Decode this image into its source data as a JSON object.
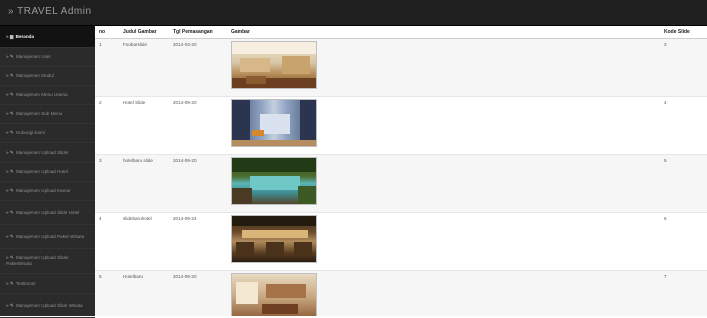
{
  "app": {
    "title": "TRAVEL Admin"
  },
  "sidebar": {
    "items": [
      {
        "icon": "home-icon",
        "label": "Beranda",
        "active": true
      },
      {
        "icon": "wrench-icon",
        "label": "Manajemen User"
      },
      {
        "icon": "wrench-icon",
        "label": "Manajemen Modul"
      },
      {
        "icon": "wrench-icon",
        "label": "Manajemen Menu Utama"
      },
      {
        "icon": "wrench-icon",
        "label": "Manajemen Sub Menu"
      },
      {
        "icon": "wrench-icon",
        "label": "Hubungi Kami"
      },
      {
        "icon": "wrench-icon",
        "label": "Manajemen Upload Slider"
      },
      {
        "icon": "wrench-icon",
        "label": "Manajemen Upload Hotel"
      },
      {
        "icon": "wrench-icon",
        "label": "Manajemen Upload Kamar"
      },
      {
        "icon": "wrench-icon",
        "label": "Manajemen Upload Slide Hotel"
      },
      {
        "icon": "wrench-icon",
        "label": "Manajemen Upload Paket Wisata"
      },
      {
        "icon": "wrench-icon",
        "label": "Manajemen Upload Slider PaketWisata"
      },
      {
        "icon": "wrench-icon",
        "label": "Testimoni"
      },
      {
        "icon": "wrench-icon",
        "label": "Manajemen Upload Slide Wisata"
      }
    ]
  },
  "table": {
    "columns": [
      "no",
      "Judul Gambar",
      "Tgl Pemasangan",
      "Gambar",
      "Kode Slide"
    ],
    "rows": [
      {
        "no": "1",
        "judul": "Foobarslide",
        "tgl": "2014-03-20",
        "image": "lobby-photo",
        "kode": "3"
      },
      {
        "no": "2",
        "judul": "Hotel Slide",
        "tgl": "2014-09-20",
        "image": "corridor-photo",
        "kode": "4"
      },
      {
        "no": "3",
        "judul": "hotelbaru slide",
        "tgl": "2014-09-20",
        "image": "pool-photo",
        "kode": "5"
      },
      {
        "no": "4",
        "judul": "slidebaruhotel",
        "tgl": "2014-09-24",
        "image": "restaurant-photo",
        "kode": "6"
      },
      {
        "no": "5",
        "judul": "Hotelbaru",
        "tgl": "2014-09-20",
        "image": "room-photo",
        "kode": "7"
      }
    ]
  }
}
